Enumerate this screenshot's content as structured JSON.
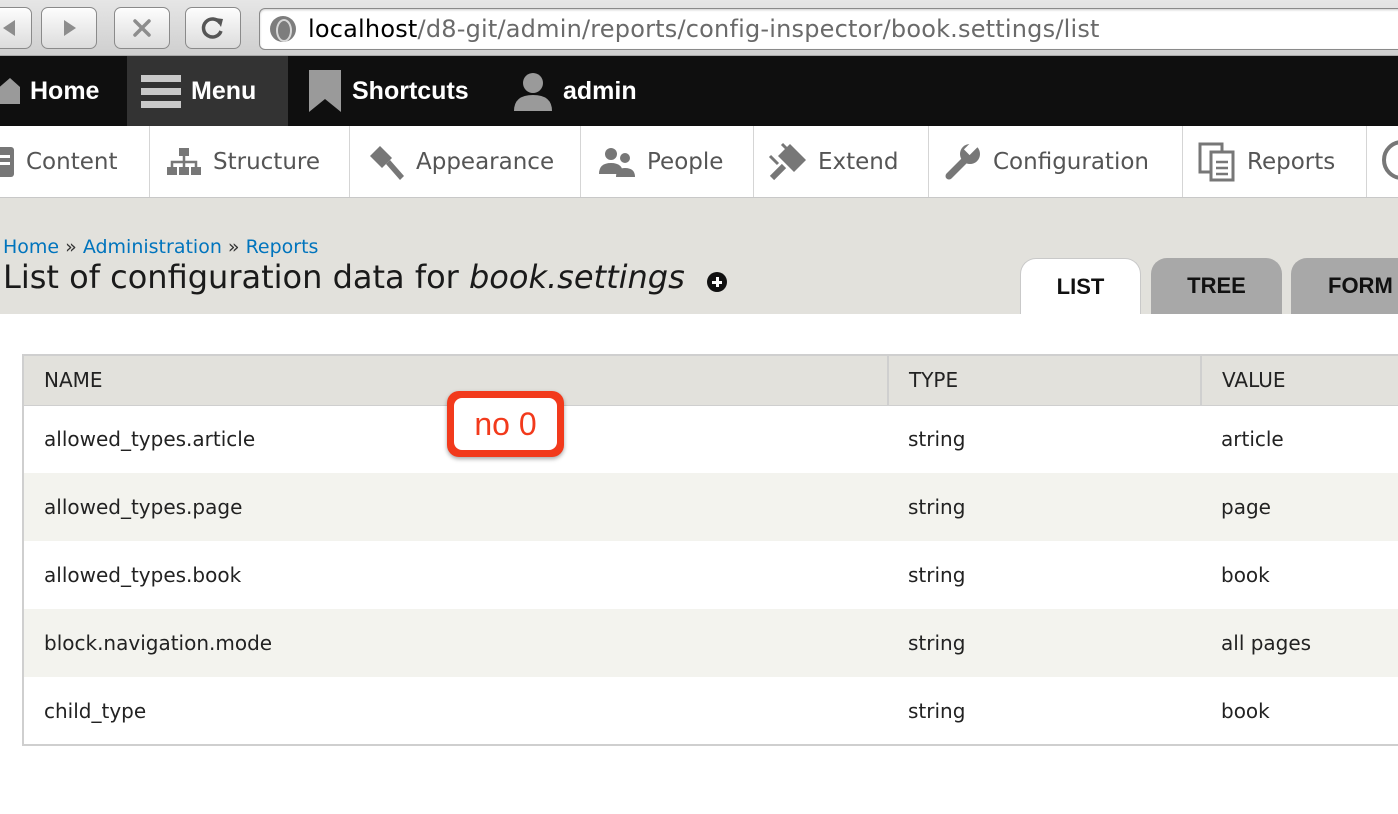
{
  "browser": {
    "url_host": "localhost",
    "url_path": "/d8-git/admin/reports/config-inspector/book.settings/list"
  },
  "toolbar": {
    "home_label": "Home",
    "menu_label": "Menu",
    "shortcuts_label": "Shortcuts",
    "admin_label": "admin"
  },
  "tray": {
    "items": [
      {
        "label": "Content",
        "icon": "document-icon"
      },
      {
        "label": "Structure",
        "icon": "sitemap-icon"
      },
      {
        "label": "Appearance",
        "icon": "paintbrush-icon"
      },
      {
        "label": "People",
        "icon": "people-icon"
      },
      {
        "label": "Extend",
        "icon": "plug-icon"
      },
      {
        "label": "Configuration",
        "icon": "wrench-icon"
      },
      {
        "label": "Reports",
        "icon": "reports-icon"
      }
    ]
  },
  "breadcrumb": {
    "items": [
      "Home",
      "Administration",
      "Reports"
    ],
    "separator": "»"
  },
  "page": {
    "title_prefix": "List of configuration data for ",
    "title_name": "book.settings"
  },
  "tabs": [
    "LIST",
    "TREE",
    "FORM"
  ],
  "table": {
    "headers": [
      "NAME",
      "TYPE",
      "VALUE"
    ],
    "rows": [
      [
        "allowed_types.article",
        "string",
        "article"
      ],
      [
        "allowed_types.page",
        "string",
        "page"
      ],
      [
        "allowed_types.book",
        "string",
        "book"
      ],
      [
        "block.navigation.mode",
        "string",
        "all pages"
      ],
      [
        "child_type",
        "string",
        "book"
      ]
    ]
  },
  "annotation": {
    "text": "no 0",
    "color": "#f23a1c"
  },
  "colors": {
    "link": "#0074bd",
    "toolbar_bg": "#0f0f0f",
    "header_bg": "#e2e1dc"
  }
}
